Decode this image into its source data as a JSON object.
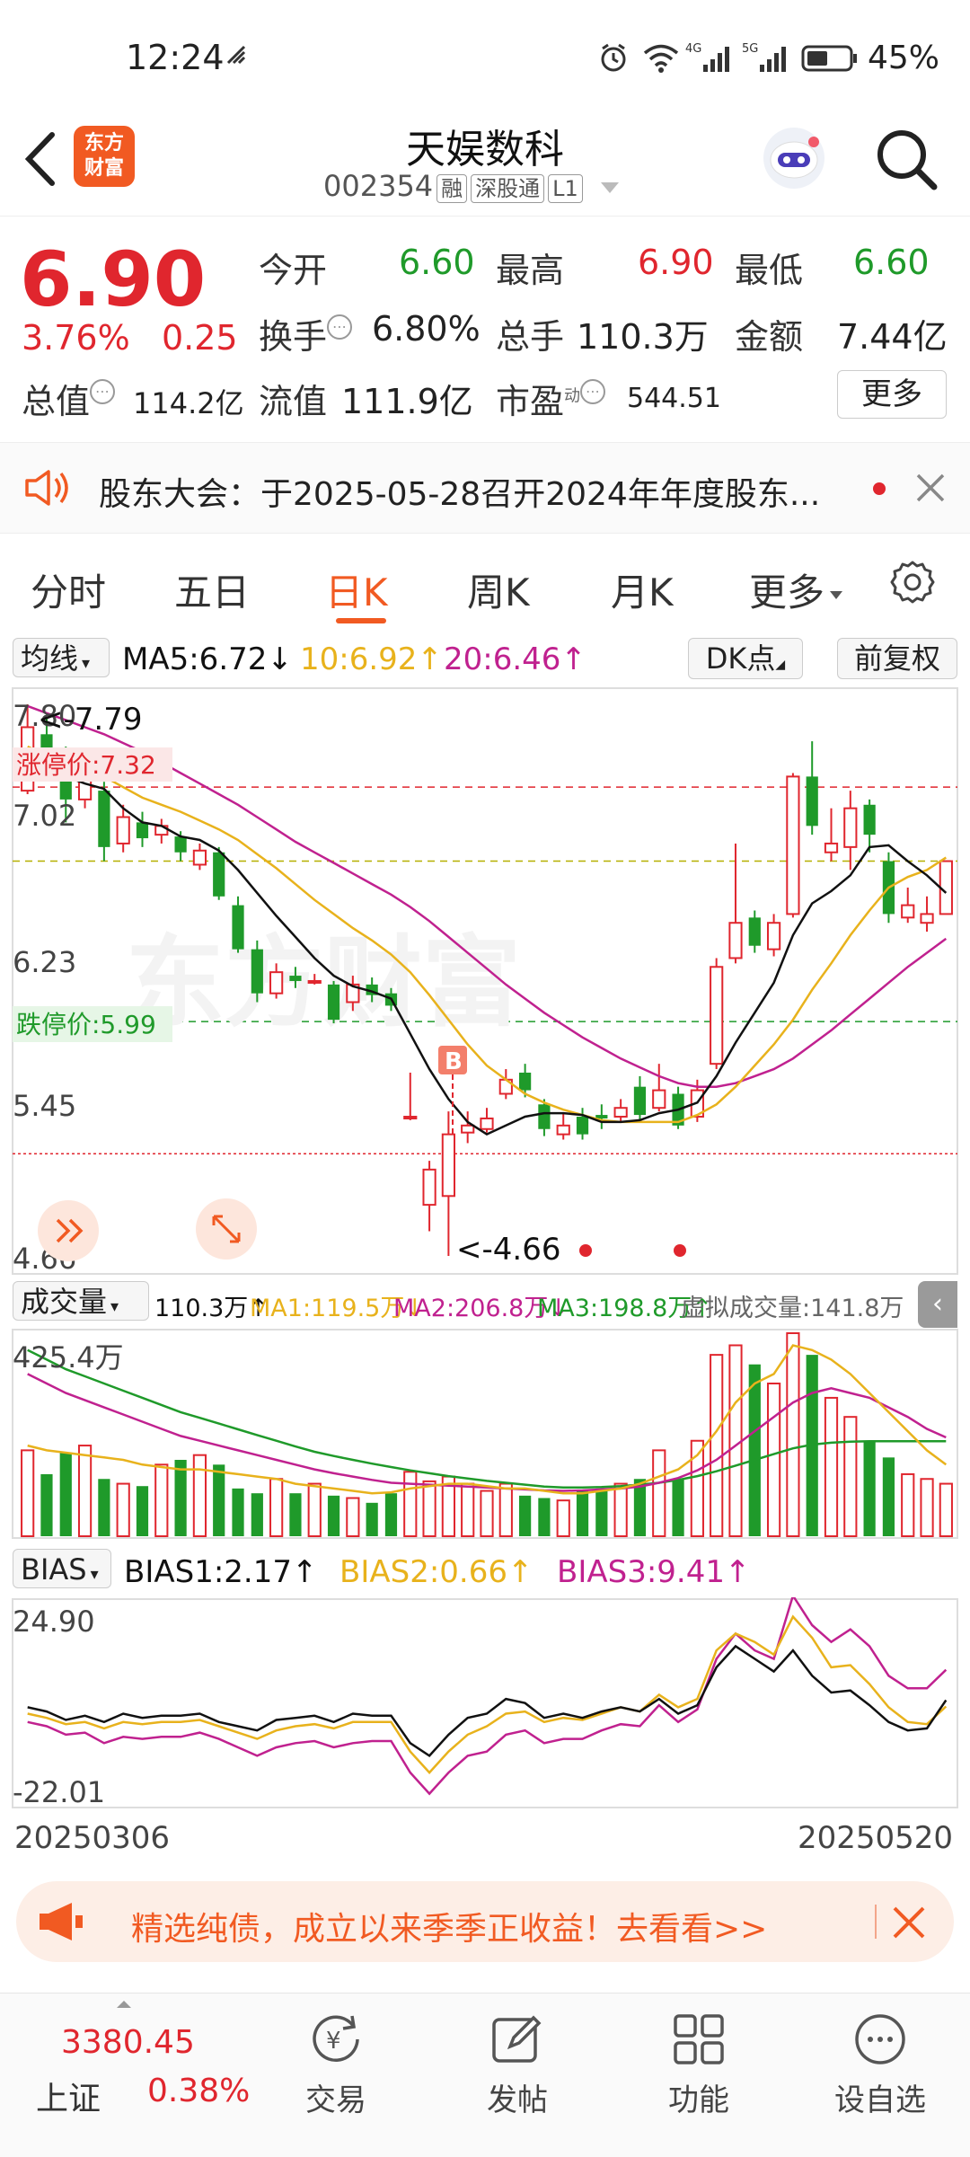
{
  "status": {
    "time": "12:24",
    "battery": "45%"
  },
  "header": {
    "brand_line1": "东方",
    "brand_line2": "财富",
    "name": "天娱数科",
    "code": "002354",
    "tags": [
      "融",
      "深股通",
      "L1"
    ]
  },
  "quote": {
    "price": "6.90",
    "change_pct": "3.76%",
    "change": "0.25",
    "open_label": "今开",
    "open": "6.60",
    "high_label": "最高",
    "high": "6.90",
    "low_label": "最低",
    "low": "6.60",
    "turnover_label": "换手",
    "turnover": "6.80%",
    "volume_label": "总手",
    "volume": "110.3万",
    "amount_label": "金额",
    "amount": "7.44亿",
    "mktcap_label": "总值",
    "mktcap": "114.2亿",
    "float_label": "流值",
    "float": "111.9亿",
    "pe_label": "市盈",
    "pe_sup": "动",
    "pe": "544.51",
    "more": "更多"
  },
  "notice": {
    "text": "股东大会：于2025-05-28召开2024年年度股东..."
  },
  "tabs": [
    "分时",
    "五日",
    "日K",
    "周K",
    "月K",
    "更多"
  ],
  "active_tab": "日K",
  "ma_bar": {
    "selector": "均线",
    "ma5": "MA5:6.72",
    "ma10": "10:6.92",
    "ma20": "20:6.46",
    "dk": "DK点",
    "fq": "前复权"
  },
  "kline": {
    "y_labels": [
      "7.80",
      "7.02",
      "6.23",
      "5.45",
      "4.66"
    ],
    "limit_up": "涨停价:7.32",
    "limit_down": "跌停价:5.99",
    "max_marker": "<-7.79",
    "min_marker": "<-4.66",
    "buy_marker": "B"
  },
  "volume_bar": {
    "selector": "成交量",
    "vol": "110.3万",
    "ma1": "MA1:119.5万",
    "ma2": "MA2:206.8万",
    "ma3": "MA3:198.8万",
    "virtual": "虚拟成交量:141.8万",
    "ymax": "425.4万"
  },
  "bias_bar": {
    "selector": "BIAS",
    "bias1": "BIAS1:2.17",
    "bias2": "BIAS2:0.66",
    "bias3": "BIAS3:9.41",
    "ymax": "24.90",
    "ymin": "-22.01"
  },
  "dates": {
    "start": "20250306",
    "end": "20250520"
  },
  "banner": {
    "text": "精选纯债，成立以来季季正收益！去看看>>"
  },
  "bottom": {
    "index_value": "3380.45",
    "index_name": "上证",
    "index_pct": "0.38%",
    "items": [
      "交易",
      "发帖",
      "功能",
      "设自选"
    ]
  },
  "colors": {
    "up": "#e0262e",
    "down": "#1f9a2a",
    "ma5": "#111111",
    "ma10": "#e8b21c",
    "ma20": "#c0218f"
  },
  "chart_data": {
    "type": "candlestick",
    "candles": [
      [
        7.3,
        7.66,
        7.79,
        7.28
      ],
      [
        7.62,
        7.45,
        7.72,
        7.4
      ],
      [
        7.42,
        7.25,
        7.55,
        7.12
      ],
      [
        7.25,
        7.4,
        7.45,
        7.2
      ],
      [
        7.3,
        6.98,
        7.35,
        6.9
      ],
      [
        7.0,
        7.15,
        7.22,
        6.95
      ],
      [
        7.12,
        7.03,
        7.18,
        6.98
      ],
      [
        7.05,
        7.1,
        7.14,
        7.0
      ],
      [
        7.04,
        6.95,
        7.07,
        6.9
      ],
      [
        6.88,
        6.96,
        7.0,
        6.85
      ],
      [
        6.95,
        6.7,
        6.98,
        6.68
      ],
      [
        6.65,
        6.4,
        6.7,
        6.38
      ],
      [
        6.4,
        6.15,
        6.45,
        6.1
      ],
      [
        6.15,
        6.27,
        6.32,
        6.12
      ],
      [
        6.25,
        6.22,
        6.3,
        6.18
      ],
      [
        6.22,
        6.22,
        6.26,
        6.2
      ],
      [
        6.2,
        6.0,
        6.22,
        5.98
      ],
      [
        6.1,
        6.2,
        6.25,
        6.05
      ],
      [
        6.2,
        6.14,
        6.24,
        6.1
      ],
      [
        6.15,
        6.08,
        6.18,
        6.05
      ],
      [
        5.45,
        5.45,
        5.7,
        5.43
      ],
      [
        4.95,
        5.15,
        5.2,
        4.8
      ],
      [
        5.0,
        5.35,
        5.48,
        4.66
      ],
      [
        5.36,
        5.4,
        5.48,
        5.3
      ],
      [
        5.38,
        5.44,
        5.5,
        5.36
      ],
      [
        5.58,
        5.66,
        5.72,
        5.55
      ],
      [
        5.7,
        5.6,
        5.75,
        5.56
      ],
      [
        5.52,
        5.38,
        5.55,
        5.34
      ],
      [
        5.35,
        5.4,
        5.47,
        5.32
      ],
      [
        5.45,
        5.35,
        5.5,
        5.32
      ],
      [
        5.46,
        5.44,
        5.52,
        5.38
      ],
      [
        5.45,
        5.5,
        5.55,
        5.42
      ],
      [
        5.62,
        5.46,
        5.68,
        5.43
      ],
      [
        5.5,
        5.6,
        5.75,
        5.48
      ],
      [
        5.58,
        5.4,
        5.62,
        5.38
      ],
      [
        5.45,
        5.6,
        5.66,
        5.42
      ],
      [
        5.75,
        6.3,
        6.35,
        5.72
      ],
      [
        6.35,
        6.55,
        7.0,
        6.32
      ],
      [
        6.58,
        6.42,
        6.62,
        6.38
      ],
      [
        6.4,
        6.55,
        6.6,
        6.36
      ],
      [
        6.6,
        7.38,
        7.4,
        6.58
      ],
      [
        7.38,
        7.1,
        7.58,
        7.05
      ],
      [
        6.95,
        7.0,
        7.2,
        6.9
      ],
      [
        6.98,
        7.2,
        7.3,
        6.85
      ],
      [
        7.22,
        7.05,
        7.25,
        6.95
      ],
      [
        6.9,
        6.6,
        6.95,
        6.55
      ],
      [
        6.58,
        6.65,
        6.75,
        6.55
      ],
      [
        6.55,
        6.6,
        6.7,
        6.5
      ],
      [
        6.6,
        6.9,
        6.9,
        6.6
      ]
    ],
    "ma5": [
      7.48,
      7.43,
      7.38,
      7.34,
      7.31,
      7.2,
      7.12,
      7.1,
      7.04,
      7.02,
      6.96,
      6.85,
      6.72,
      6.59,
      6.47,
      6.35,
      6.25,
      6.19,
      6.16,
      6.12,
      5.92,
      5.72,
      5.55,
      5.42,
      5.35,
      5.4,
      5.45,
      5.47,
      5.47,
      5.46,
      5.42,
      5.42,
      5.43,
      5.47,
      5.49,
      5.53,
      5.68,
      5.87,
      6.04,
      6.21,
      6.48,
      6.66,
      6.73,
      6.82,
      6.98,
      6.99,
      6.9,
      6.82,
      6.72
    ],
    "ma10": [
      7.55,
      7.5,
      7.46,
      7.42,
      7.38,
      7.32,
      7.26,
      7.22,
      7.18,
      7.13,
      7.08,
      7.02,
      6.94,
      6.86,
      6.77,
      6.68,
      6.6,
      6.52,
      6.45,
      6.37,
      6.27,
      6.14,
      6.0,
      5.86,
      5.74,
      5.66,
      5.58,
      5.53,
      5.49,
      5.46,
      5.43,
      5.42,
      5.42,
      5.42,
      5.42,
      5.46,
      5.52,
      5.62,
      5.74,
      5.86,
      6.0,
      6.17,
      6.32,
      6.48,
      6.62,
      6.75,
      6.81,
      6.85,
      6.92
    ],
    "ma20": [
      7.78,
      7.74,
      7.7,
      7.66,
      7.62,
      7.57,
      7.52,
      7.46,
      7.4,
      7.34,
      7.28,
      7.22,
      7.15,
      7.08,
      7.01,
      6.95,
      6.89,
      6.83,
      6.77,
      6.71,
      6.64,
      6.56,
      6.47,
      6.38,
      6.29,
      6.2,
      6.12,
      6.04,
      5.97,
      5.9,
      5.84,
      5.78,
      5.73,
      5.68,
      5.64,
      5.62,
      5.62,
      5.64,
      5.68,
      5.72,
      5.78,
      5.86,
      5.94,
      6.03,
      6.12,
      6.21,
      6.3,
      6.38,
      6.46
    ],
    "volume": [
      180,
      130,
      175,
      190,
      120,
      110,
      105,
      150,
      160,
      170,
      150,
      100,
      90,
      120,
      90,
      110,
      85,
      80,
      70,
      90,
      135,
      115,
      125,
      110,
      95,
      110,
      85,
      80,
      75,
      95,
      100,
      110,
      120,
      180,
      120,
      200,
      380,
      400,
      360,
      320,
      500,
      380,
      290,
      250,
      200,
      165,
      130,
      120,
      110
    ],
    "vol_ma1": [
      190,
      180,
      175,
      170,
      165,
      160,
      150,
      145,
      140,
      140,
      135,
      130,
      125,
      120,
      110,
      105,
      100,
      95,
      90,
      92,
      100,
      105,
      110,
      110,
      105,
      100,
      100,
      95,
      90,
      90,
      95,
      100,
      110,
      125,
      140,
      170,
      220,
      280,
      320,
      340,
      400,
      390,
      370,
      340,
      300,
      260,
      220,
      180,
      150
    ],
    "vol_ma2": [
      340,
      320,
      300,
      285,
      270,
      255,
      240,
      225,
      210,
      200,
      190,
      180,
      170,
      160,
      150,
      140,
      132,
      125,
      118,
      112,
      110,
      108,
      106,
      104,
      102,
      100,
      98,
      96,
      95,
      96,
      98,
      100,
      104,
      112,
      122,
      138,
      160,
      190,
      220,
      250,
      280,
      300,
      310,
      300,
      290,
      270,
      250,
      225,
      207
    ],
    "vol_ma3": [
      390,
      370,
      350,
      335,
      320,
      305,
      290,
      275,
      260,
      248,
      236,
      224,
      212,
      200,
      188,
      177,
      168,
      160,
      152,
      145,
      138,
      132,
      126,
      121,
      116,
      112,
      108,
      104,
      102,
      102,
      103,
      105,
      108,
      112,
      118,
      126,
      136,
      148,
      160,
      172,
      184,
      192,
      196,
      198,
      199,
      199,
      199,
      199,
      199
    ],
    "bias1": [
      0.5,
      -0.5,
      -2.5,
      -1.5,
      -3.0,
      -1.0,
      -2.0,
      -1.5,
      -1.5,
      -1.0,
      -3.0,
      -4.0,
      -5.0,
      -2.5,
      -2.0,
      -1.5,
      -3.0,
      -1.0,
      -1.5,
      -1.5,
      -8.0,
      -11.0,
      -6.0,
      -2.0,
      -1.0,
      2.5,
      1.5,
      -2.0,
      -1.0,
      -2.0,
      -0.5,
      0.5,
      -0.5,
      2.5,
      -1.0,
      1.0,
      10.0,
      15.0,
      12.0,
      9.0,
      14.0,
      8.0,
      4.0,
      4.5,
      1.0,
      -3.0,
      -5.0,
      -4.5,
      2.2
    ],
    "bias2": [
      -1.0,
      -2.0,
      -3.5,
      -3.0,
      -4.5,
      -3.0,
      -3.5,
      -3.0,
      -3.0,
      -2.5,
      -4.0,
      -5.5,
      -7.0,
      -5.0,
      -4.0,
      -3.5,
      -4.5,
      -3.0,
      -3.0,
      -3.0,
      -10.0,
      -15.0,
      -10.0,
      -6.0,
      -4.0,
      -1.0,
      -0.5,
      -3.0,
      -2.0,
      -2.5,
      -1.0,
      0.5,
      -0.5,
      3.5,
      0.5,
      2.5,
      14.0,
      18.0,
      16.0,
      13.0,
      22.0,
      17.0,
      10.0,
      10.5,
      6.0,
      0.5,
      -3.0,
      -3.5,
      0.7
    ],
    "bias3": [
      -3.0,
      -4.0,
      -6.0,
      -5.5,
      -8.0,
      -6.5,
      -7.0,
      -6.5,
      -6.5,
      -5.5,
      -7.0,
      -9.0,
      -11.0,
      -9.0,
      -8.0,
      -7.5,
      -9.0,
      -8.0,
      -7.5,
      -7.5,
      -15.0,
      -20.0,
      -15.0,
      -11.0,
      -10.0,
      -6.0,
      -5.0,
      -8.0,
      -7.0,
      -7.0,
      -5.0,
      -3.5,
      -4.0,
      1.0,
      -3.0,
      0.0,
      12.0,
      18.0,
      14.0,
      12.0,
      27.0,
      20.0,
      16.0,
      19.0,
      15.0,
      8.0,
      5.0,
      5.0,
      9.4
    ]
  }
}
